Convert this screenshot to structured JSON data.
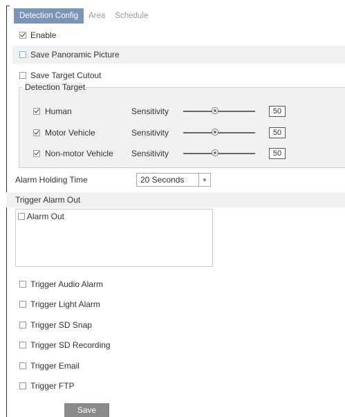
{
  "tabs": [
    {
      "label": "Detection Config",
      "active": true
    },
    {
      "label": "Area",
      "active": false
    },
    {
      "label": "Schedule",
      "active": false
    }
  ],
  "options": {
    "enable": {
      "label": "Enable",
      "checked": true
    },
    "save_panoramic": {
      "label": "Save Panoramic Picture",
      "checked": false
    },
    "save_cutout": {
      "label": "Save Target Cutout",
      "checked": false
    }
  },
  "detection_target": {
    "legend": "Detection Target",
    "sensitivity_label": "Sensitivity",
    "targets": [
      {
        "name": "Human",
        "checked": true,
        "sensitivity": 50
      },
      {
        "name": "Motor Vehicle",
        "checked": true,
        "sensitivity": 50
      },
      {
        "name": "Non-motor Vehicle",
        "checked": true,
        "sensitivity": 50
      }
    ]
  },
  "alarm_holding": {
    "label": "Alarm Holding Time",
    "value": "20 Seconds"
  },
  "trigger_alarm_out": {
    "label": "Trigger Alarm Out",
    "items": [
      {
        "label": "Alarm Out",
        "checked": false
      }
    ]
  },
  "triggers": [
    {
      "label": "Trigger Audio Alarm",
      "checked": false
    },
    {
      "label": "Trigger Light Alarm",
      "checked": false
    },
    {
      "label": "Trigger SD Snap",
      "checked": false
    },
    {
      "label": "Trigger SD Recording",
      "checked": false
    },
    {
      "label": "Trigger Email",
      "checked": false
    },
    {
      "label": "Trigger FTP",
      "checked": false
    }
  ],
  "save_label": "Save",
  "colors": {
    "active_tab": "#7a95b5",
    "row_shade": "#f1f1f1",
    "save_button": "#8a8a8a"
  }
}
